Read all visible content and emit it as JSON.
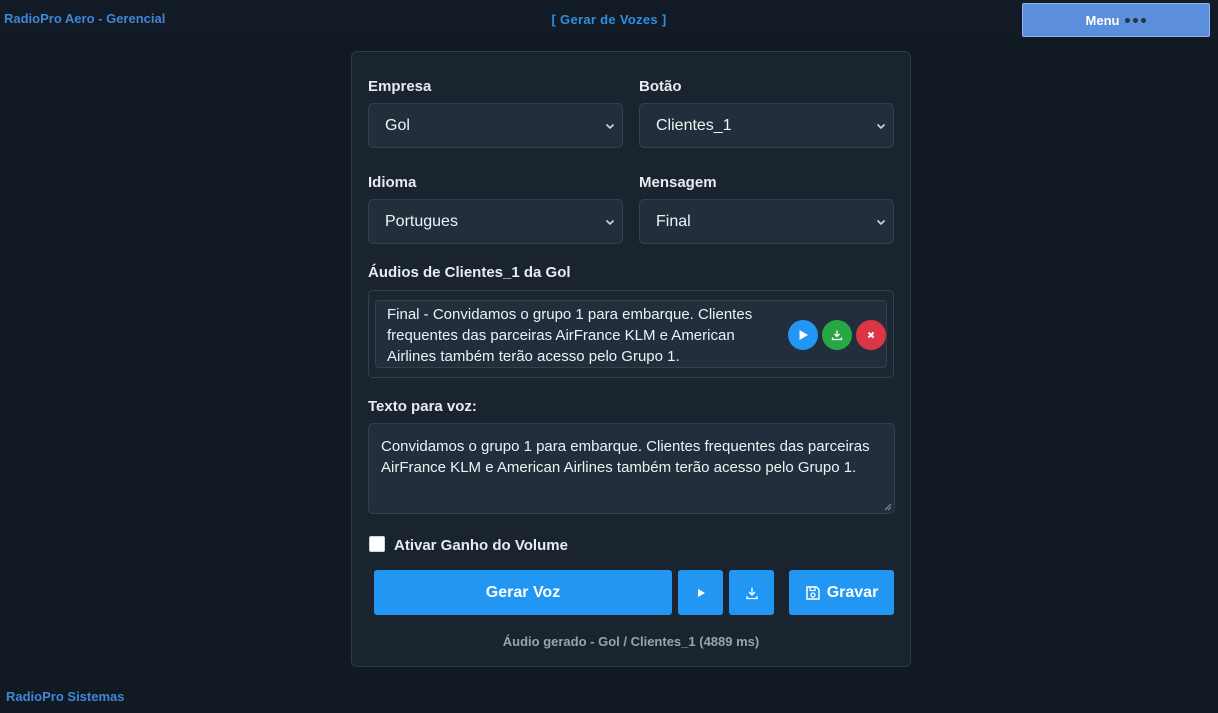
{
  "header": {
    "app_title": "RadioPro Aero - Gerencial",
    "page_title": "[ Gerar de Vozes ]",
    "menu_label": "Menu"
  },
  "form": {
    "empresa_label": "Empresa",
    "empresa_value": "Gol",
    "botao_label": "Botão",
    "botao_value": "Clientes_1",
    "idioma_label": "Idioma",
    "idioma_value": "Portugues",
    "mensagem_label": "Mensagem",
    "mensagem_value": "Final",
    "audios_label": "Áudios de Clientes_1 da Gol",
    "audio_items": [
      {
        "text": "Final - Convidamos o grupo 1 para embarque. Clientes frequentes das parceiras AirFrance KLM e American Airlines também terão acesso pelo Grupo 1."
      }
    ],
    "texto_label": "Texto para voz:",
    "texto_value": "Convidamos o grupo 1 para embarque. Clientes frequentes das parceiras AirFrance KLM e American Airlines também terão acesso pelo Grupo 1.",
    "ganho_label": "Ativar Ganho do Volume",
    "ganho_checked": false
  },
  "actions": {
    "gerar_label": "Gerar Voz",
    "gravar_label": "Gravar"
  },
  "status_text": "Áudio gerado - Gol / Clientes_1 (4889 ms)",
  "footer_text": "RadioPro Sistemas",
  "colors": {
    "accent": "#2196f3",
    "play": "#2196f3",
    "download": "#28a745",
    "delete": "#dc3545",
    "menu": "#5b8fdc"
  }
}
